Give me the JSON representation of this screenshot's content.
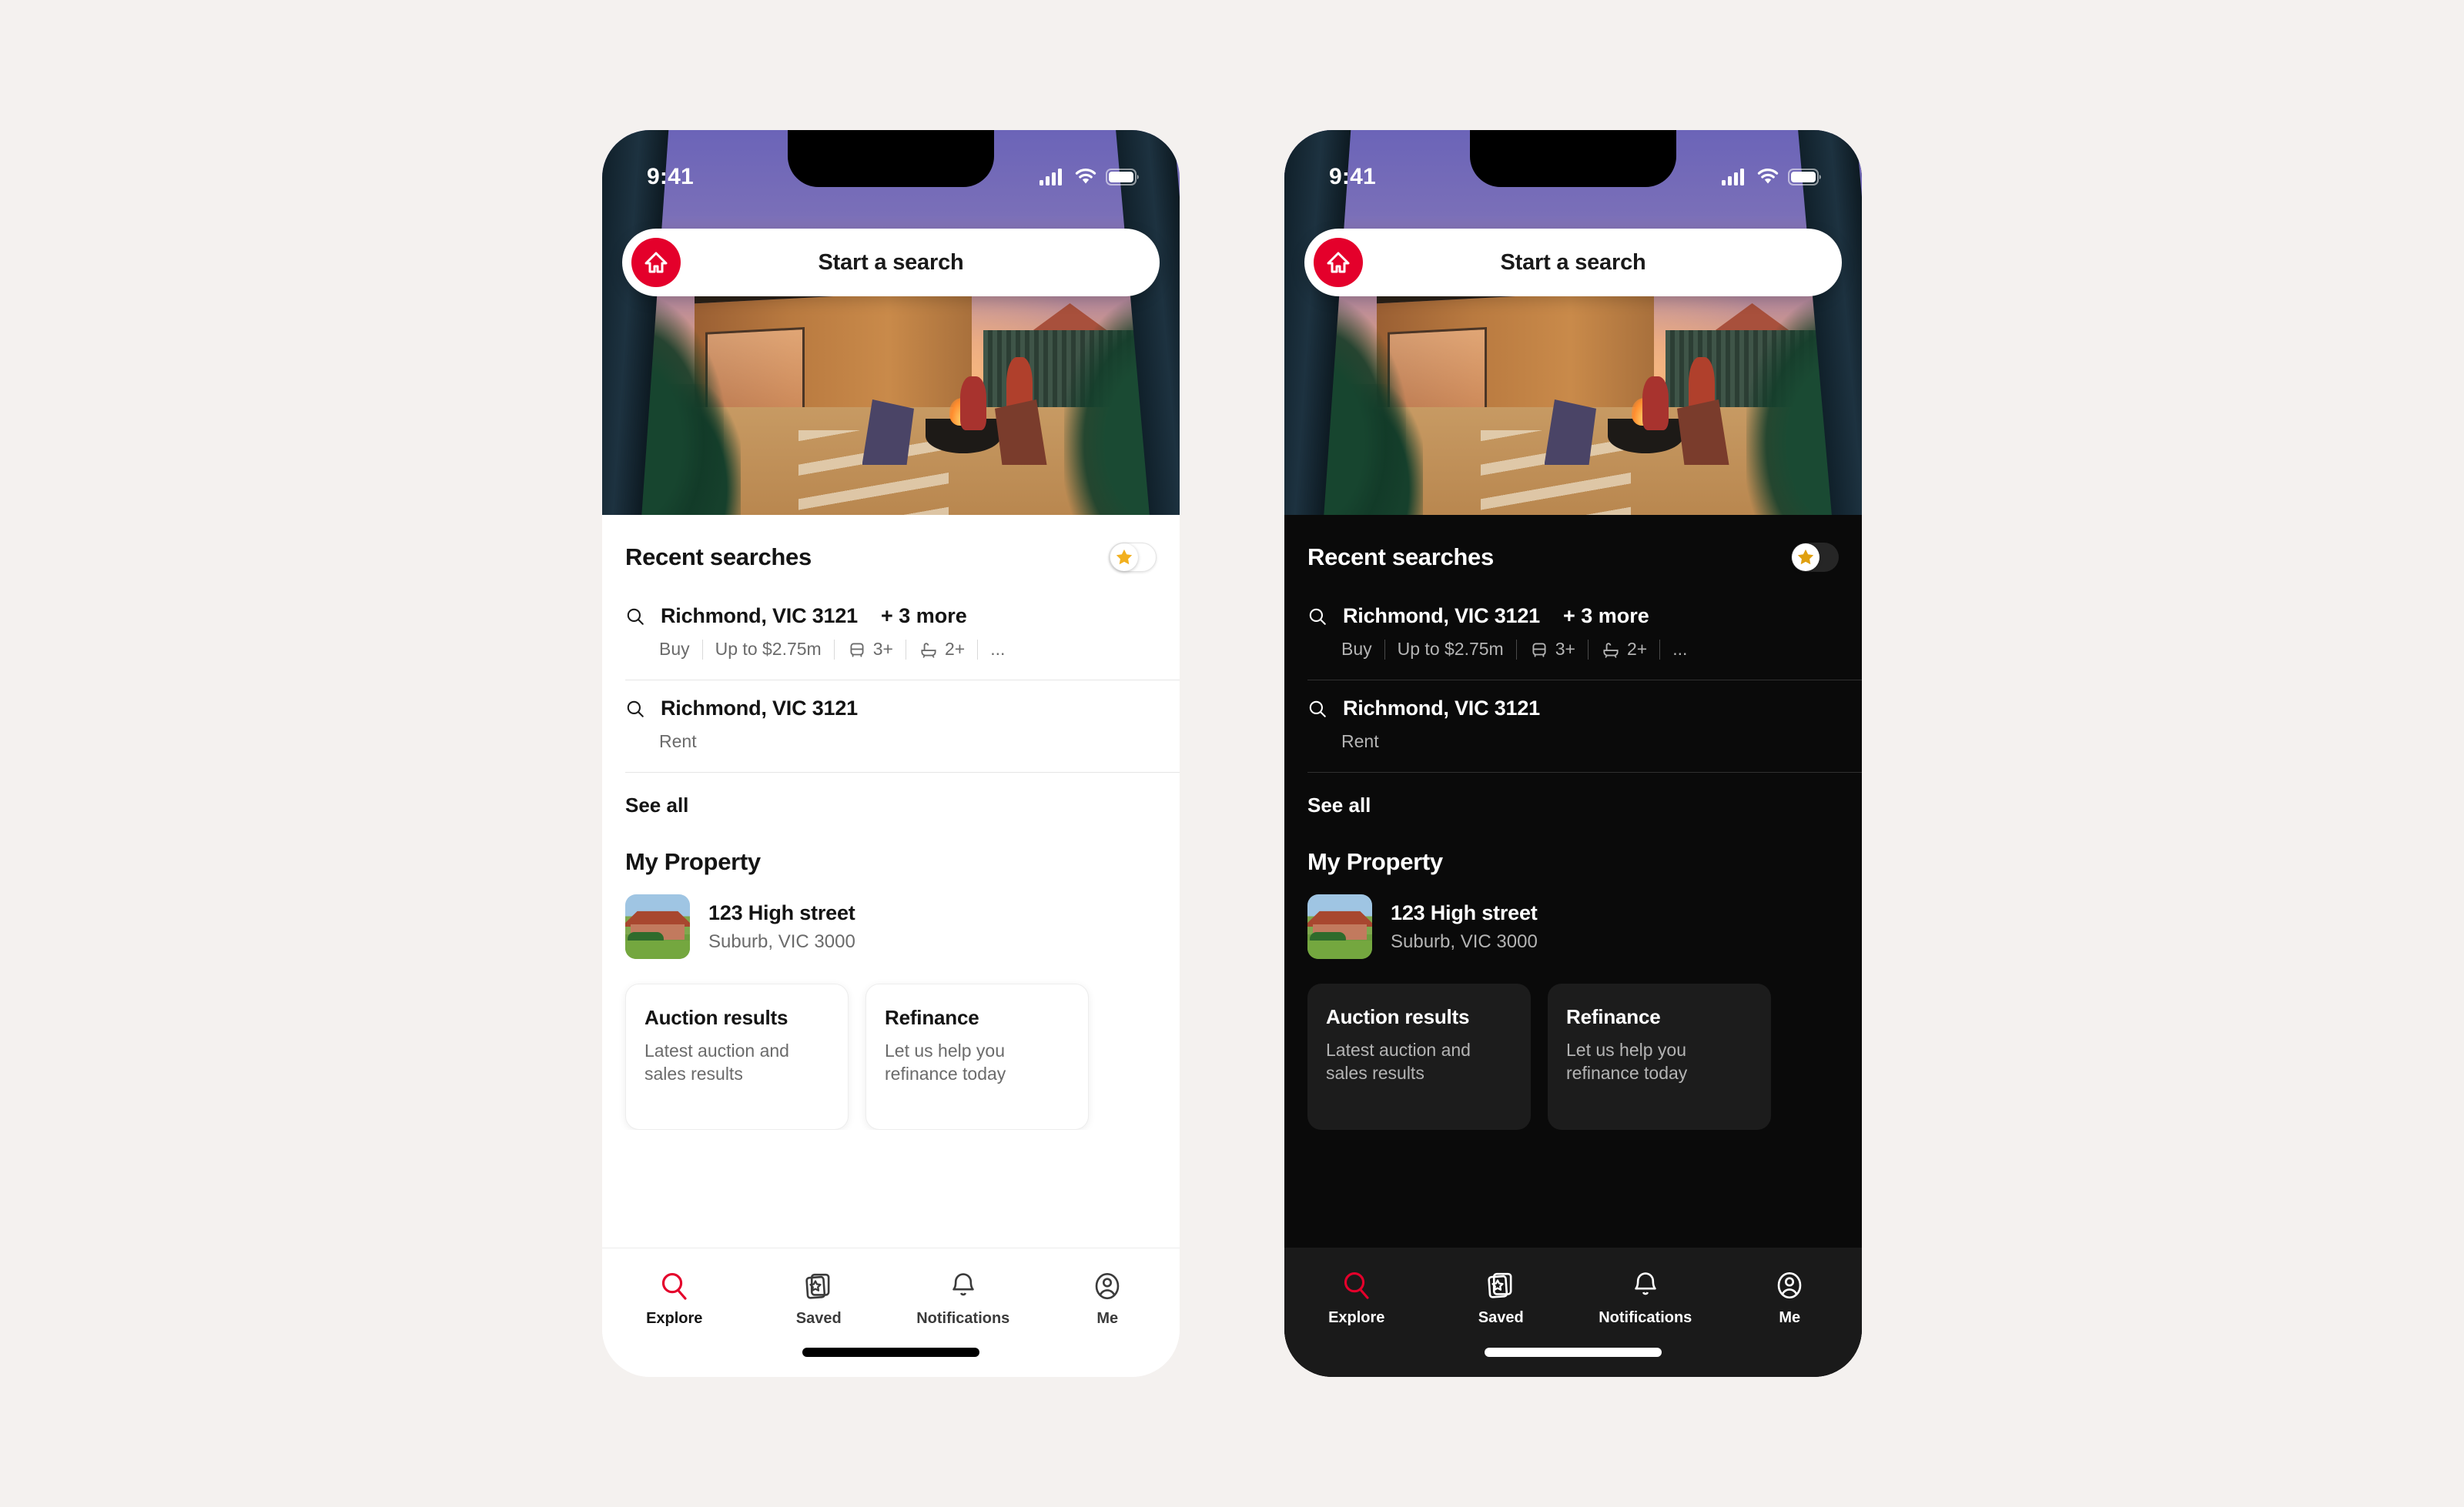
{
  "canvas": {
    "background": "#f4f1ef"
  },
  "brand": {
    "accent": "#e4002b",
    "star": "#f2b01e"
  },
  "status_bar": {
    "time": "9:41",
    "signal_icon": "cellular-signal-icon",
    "wifi_icon": "wifi-icon",
    "battery_icon": "battery-icon"
  },
  "search": {
    "placeholder": "Start a search",
    "logo_icon": "house-logo-icon"
  },
  "recent": {
    "heading": "Recent searches",
    "toggle_icon": "star-icon",
    "see_all": "See all",
    "items": [
      {
        "search_icon": "search-icon",
        "location": "Richmond, VIC 3121",
        "more": "+ 3 more",
        "meta": {
          "mode": "Buy",
          "price": "Up to $2.75m",
          "beds": "3+",
          "beds_icon": "bed-icon",
          "baths": "2+",
          "baths_icon": "bath-icon",
          "overflow": "..."
        }
      },
      {
        "search_icon": "search-icon",
        "location": "Richmond, VIC 3121",
        "more": "",
        "meta": {
          "mode": "Rent"
        }
      }
    ]
  },
  "my_property": {
    "heading": "My Property",
    "address": "123 High street",
    "suburb": "Suburb, VIC 3000",
    "thumb_alt": "property-photo"
  },
  "cards": [
    {
      "title": "Auction results",
      "subtitle": "Latest auction and sales results"
    },
    {
      "title": "Refinance",
      "subtitle": "Let us help you refinance today"
    }
  ],
  "tabs": [
    {
      "label": "Explore",
      "icon": "search-icon",
      "active": true
    },
    {
      "label": "Saved",
      "icon": "saved-cards-star-icon",
      "active": false
    },
    {
      "label": "Notifications",
      "icon": "bell-icon",
      "active": false
    },
    {
      "label": "Me",
      "icon": "person-circle-icon",
      "active": false
    }
  ],
  "themes": {
    "light": "light",
    "dark": "dark"
  }
}
